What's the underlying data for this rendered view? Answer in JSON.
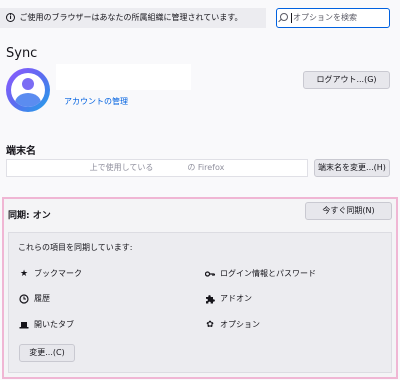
{
  "notice": {
    "icon": "info-icon",
    "text": "ご使用のブラウザーはあなたの所属組織に管理されています。"
  },
  "search": {
    "placeholder": "オプションを検索",
    "icon": "search-icon"
  },
  "sync": {
    "title": "Sync",
    "manage_account_link": "アカウントの管理",
    "logout_button": "ログアウト...(G)"
  },
  "device": {
    "label": "端末名",
    "name_part1": "上で使用している",
    "name_part2": "の Firefox",
    "rename_button": "端末名を変更...(H)"
  },
  "sync_section": {
    "status": "同期: オン",
    "sync_now_button": "今すぐ同期(N)",
    "description": "これらの項目を同期しています:",
    "items_left": [
      {
        "icon": "star-icon",
        "label": "ブックマーク"
      },
      {
        "icon": "clock-icon",
        "label": "履歴"
      },
      {
        "icon": "tabs-icon",
        "label": "開いたタブ"
      }
    ],
    "items_right": [
      {
        "icon": "key-icon",
        "label": "ログイン情報とパスワード"
      },
      {
        "icon": "puzzle-icon",
        "label": "アドオン"
      },
      {
        "icon": "gear-icon",
        "label": "オプション"
      }
    ],
    "change_button": "変更...(C)"
  },
  "colors": {
    "accent": "#0061e0",
    "highlight_border": "#f0b6d4"
  }
}
